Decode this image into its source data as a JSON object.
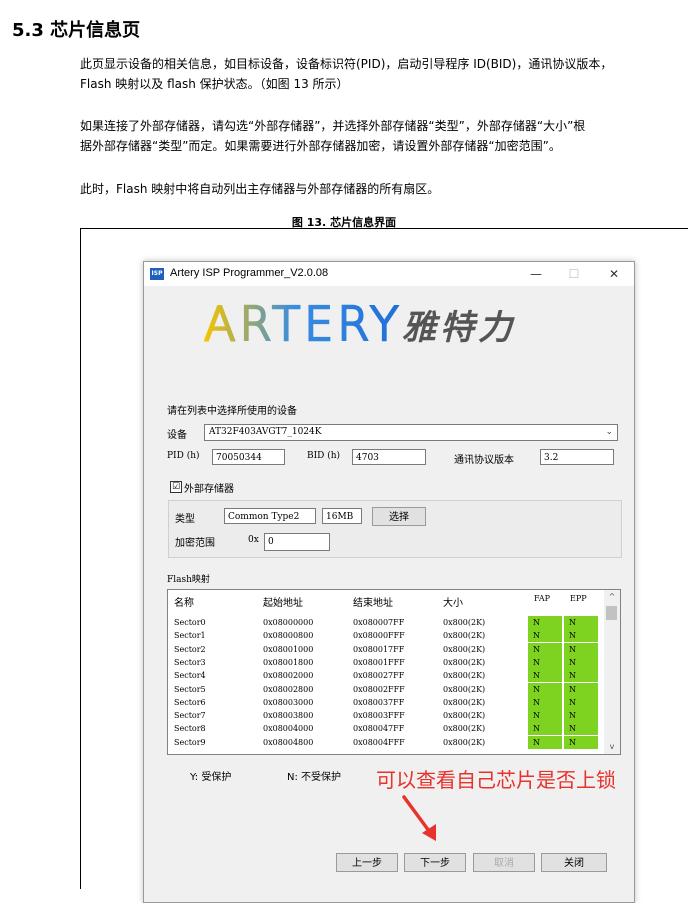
{
  "doc": {
    "heading": "5.3 芯片信息页",
    "para1_line1": "此页显示设备的相关信息，如目标设备，设备标识符(PID)，启动引导程序 ID(BID)，通讯协议版本，",
    "para1_line2": "Flash 映射以及 flash 保护状态。（如图 13 所示）",
    "para2_line1": "如果连接了外部存储器，请勾选“外部存储器”，并选择外部存储器“类型”，外部存储器“大小”根",
    "para2_line2": "据外部存储器“类型”而定。如果需要进行外部存储器加密，请设置外部存储器“加密范围”。",
    "para3": "此时，Flash 映射中将自动列出主存储器与外部存储器的所有扇区。",
    "caption": "图 13. 芯片信息界面"
  },
  "window": {
    "title": "Artery ISP Programmer_V2.0.08",
    "icon_text": "ISP",
    "minimize": "—",
    "maximize": "☐",
    "close": "✕"
  },
  "logo": {
    "brand": "ARTERY",
    "cn": "雅特力"
  },
  "form": {
    "select_prompt": "请在列表中选择所使用的设备",
    "device_label": "设备",
    "device_value": "AT32F403AVGT7_1024K",
    "pid_label": "PID (h)",
    "pid_value": "70050344",
    "bid_label": "BID (h)",
    "bid_value": "4703",
    "protocol_label": "通讯协议版本",
    "protocol_value": "3.2",
    "ext_mem_check": "☑",
    "ext_mem_label": "外部存储器",
    "type_label": "类型",
    "type_value": "Common Type2",
    "size_value": "16MB",
    "select_btn": "选择",
    "enc_label": "加密范围",
    "enc_prefix": "0x",
    "enc_value": "0"
  },
  "flash": {
    "label": "Flash映射",
    "headers": {
      "name": "名称",
      "start": "起始地址",
      "end": "结束地址",
      "size": "大小",
      "fap": "FAP",
      "epp": "EPP"
    },
    "rows": [
      {
        "name": "Sector0",
        "start": "0x08000000",
        "end": "0x080007FF",
        "size": "0x800(2K)",
        "fap": "N",
        "epp": "N"
      },
      {
        "name": "Sector1",
        "start": "0x08000800",
        "end": "0x08000FFF",
        "size": "0x800(2K)",
        "fap": "N",
        "epp": "N"
      },
      {
        "name": "Sector2",
        "start": "0x08001000",
        "end": "0x080017FF",
        "size": "0x800(2K)",
        "fap": "N",
        "epp": "N"
      },
      {
        "name": "Sector3",
        "start": "0x08001800",
        "end": "0x08001FFF",
        "size": "0x800(2K)",
        "fap": "N",
        "epp": "N"
      },
      {
        "name": "Sector4",
        "start": "0x08002000",
        "end": "0x080027FF",
        "size": "0x800(2K)",
        "fap": "N",
        "epp": "N"
      },
      {
        "name": "Sector5",
        "start": "0x08002800",
        "end": "0x08002FFF",
        "size": "0x800(2K)",
        "fap": "N",
        "epp": "N"
      },
      {
        "name": "Sector6",
        "start": "0x08003000",
        "end": "0x080037FF",
        "size": "0x800(2K)",
        "fap": "N",
        "epp": "N"
      },
      {
        "name": "Sector7",
        "start": "0x08003800",
        "end": "0x08003FFF",
        "size": "0x800(2K)",
        "fap": "N",
        "epp": "N"
      },
      {
        "name": "Sector8",
        "start": "0x08004000",
        "end": "0x080047FF",
        "size": "0x800(2K)",
        "fap": "N",
        "epp": "N"
      },
      {
        "name": "Sector9",
        "start": "0x08004800",
        "end": "0x08004FFF",
        "size": "0x800(2K)",
        "fap": "N",
        "epp": "N"
      }
    ],
    "scroll_up": "^",
    "scroll_down": "v"
  },
  "legend": {
    "y": "Y: 受保护",
    "n": "N: 不受保护"
  },
  "buttons": {
    "prev": "上一步",
    "next": "下一步",
    "cancel": "取消",
    "close": "关闭"
  },
  "annotation": {
    "text": "可以查看自己芯片是否上锁",
    "color": "#e8322c"
  },
  "colors": {
    "flag_green": "#7ed321",
    "logo_gradient_start": "#f6c400",
    "logo_gradient_end": "#1e6fd9"
  }
}
